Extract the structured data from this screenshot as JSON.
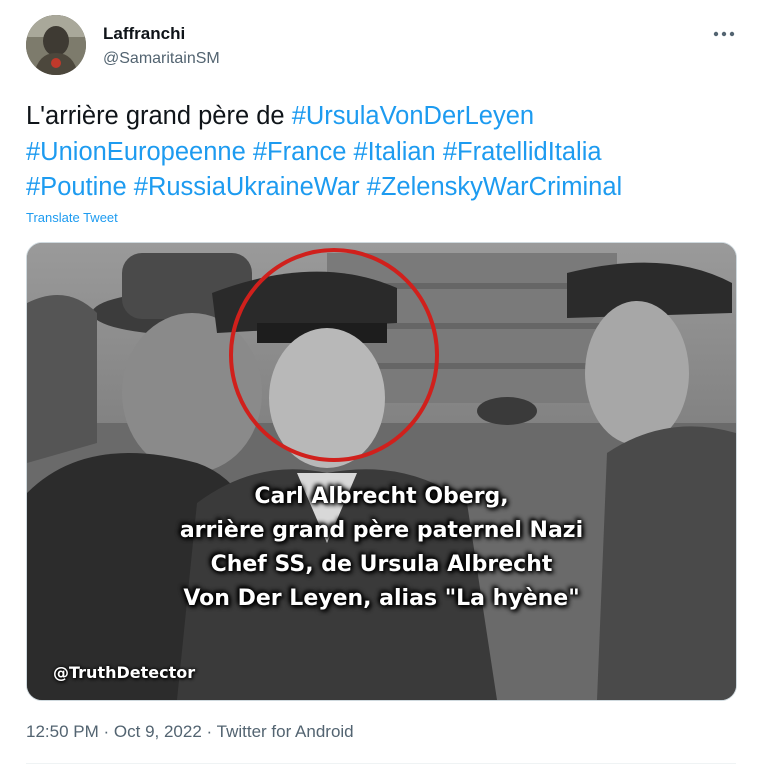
{
  "author": {
    "display_name": "Laffranchi",
    "handle": "@SamaritainSM"
  },
  "tweet": {
    "text_prefix": "L'arrière grand père de ",
    "hashtags": [
      "#UrsulaVonDerLeyen",
      "#UnionEuropeenne",
      "#France",
      "#Italian",
      "#FratellidItalia",
      "#Poutine",
      "#RussiaUkraineWar",
      "#ZelenskyWarCriminal"
    ],
    "translate_label": "Translate Tweet"
  },
  "media": {
    "caption_lines": [
      "Carl Albrecht Oberg,",
      "arrière grand père paternel Nazi",
      "Chef SS, de Ursula Albrecht",
      "Von Der Leyen, alias \"La hyène\""
    ],
    "watermark": "@TruthDetector",
    "highlight_color": "#d0201c"
  },
  "meta": {
    "time": "12:50 PM",
    "date": "Oct 9, 2022",
    "separator": "·",
    "source": "Twitter for Android"
  },
  "colors": {
    "link": "#1d9bf0",
    "text": "#0f1419",
    "secondary": "#536471"
  },
  "icons": {
    "more": "more-horizontal-icon"
  }
}
